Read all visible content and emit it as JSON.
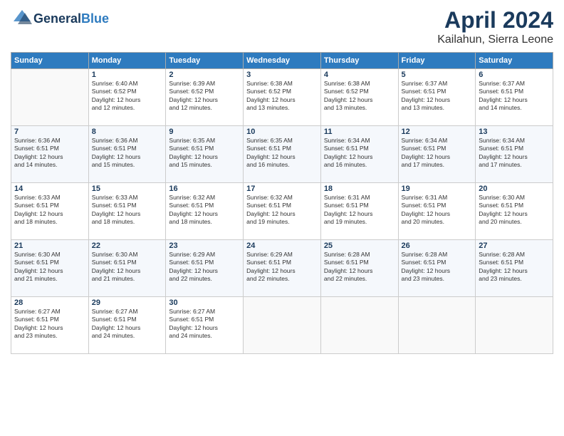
{
  "header": {
    "logo_general": "General",
    "logo_blue": "Blue",
    "month_title": "April 2024",
    "location": "Kailahun, Sierra Leone"
  },
  "days_of_week": [
    "Sunday",
    "Monday",
    "Tuesday",
    "Wednesday",
    "Thursday",
    "Friday",
    "Saturday"
  ],
  "weeks": [
    [
      {
        "day": "",
        "sunrise": "",
        "sunset": "",
        "daylight": ""
      },
      {
        "day": "1",
        "sunrise": "Sunrise: 6:40 AM",
        "sunset": "Sunset: 6:52 PM",
        "daylight": "Daylight: 12 hours and 12 minutes."
      },
      {
        "day": "2",
        "sunrise": "Sunrise: 6:39 AM",
        "sunset": "Sunset: 6:52 PM",
        "daylight": "Daylight: 12 hours and 12 minutes."
      },
      {
        "day": "3",
        "sunrise": "Sunrise: 6:38 AM",
        "sunset": "Sunset: 6:52 PM",
        "daylight": "Daylight: 12 hours and 13 minutes."
      },
      {
        "day": "4",
        "sunrise": "Sunrise: 6:38 AM",
        "sunset": "Sunset: 6:52 PM",
        "daylight": "Daylight: 12 hours and 13 minutes."
      },
      {
        "day": "5",
        "sunrise": "Sunrise: 6:37 AM",
        "sunset": "Sunset: 6:51 PM",
        "daylight": "Daylight: 12 hours and 13 minutes."
      },
      {
        "day": "6",
        "sunrise": "Sunrise: 6:37 AM",
        "sunset": "Sunset: 6:51 PM",
        "daylight": "Daylight: 12 hours and 14 minutes."
      }
    ],
    [
      {
        "day": "7",
        "sunrise": "Sunrise: 6:36 AM",
        "sunset": "Sunset: 6:51 PM",
        "daylight": "Daylight: 12 hours and 14 minutes."
      },
      {
        "day": "8",
        "sunrise": "Sunrise: 6:36 AM",
        "sunset": "Sunset: 6:51 PM",
        "daylight": "Daylight: 12 hours and 15 minutes."
      },
      {
        "day": "9",
        "sunrise": "Sunrise: 6:35 AM",
        "sunset": "Sunset: 6:51 PM",
        "daylight": "Daylight: 12 hours and 15 minutes."
      },
      {
        "day": "10",
        "sunrise": "Sunrise: 6:35 AM",
        "sunset": "Sunset: 6:51 PM",
        "daylight": "Daylight: 12 hours and 16 minutes."
      },
      {
        "day": "11",
        "sunrise": "Sunrise: 6:34 AM",
        "sunset": "Sunset: 6:51 PM",
        "daylight": "Daylight: 12 hours and 16 minutes."
      },
      {
        "day": "12",
        "sunrise": "Sunrise: 6:34 AM",
        "sunset": "Sunset: 6:51 PM",
        "daylight": "Daylight: 12 hours and 17 minutes."
      },
      {
        "day": "13",
        "sunrise": "Sunrise: 6:34 AM",
        "sunset": "Sunset: 6:51 PM",
        "daylight": "Daylight: 12 hours and 17 minutes."
      }
    ],
    [
      {
        "day": "14",
        "sunrise": "Sunrise: 6:33 AM",
        "sunset": "Sunset: 6:51 PM",
        "daylight": "Daylight: 12 hours and 18 minutes."
      },
      {
        "day": "15",
        "sunrise": "Sunrise: 6:33 AM",
        "sunset": "Sunset: 6:51 PM",
        "daylight": "Daylight: 12 hours and 18 minutes."
      },
      {
        "day": "16",
        "sunrise": "Sunrise: 6:32 AM",
        "sunset": "Sunset: 6:51 PM",
        "daylight": "Daylight: 12 hours and 18 minutes."
      },
      {
        "day": "17",
        "sunrise": "Sunrise: 6:32 AM",
        "sunset": "Sunset: 6:51 PM",
        "daylight": "Daylight: 12 hours and 19 minutes."
      },
      {
        "day": "18",
        "sunrise": "Sunrise: 6:31 AM",
        "sunset": "Sunset: 6:51 PM",
        "daylight": "Daylight: 12 hours and 19 minutes."
      },
      {
        "day": "19",
        "sunrise": "Sunrise: 6:31 AM",
        "sunset": "Sunset: 6:51 PM",
        "daylight": "Daylight: 12 hours and 20 minutes."
      },
      {
        "day": "20",
        "sunrise": "Sunrise: 6:30 AM",
        "sunset": "Sunset: 6:51 PM",
        "daylight": "Daylight: 12 hours and 20 minutes."
      }
    ],
    [
      {
        "day": "21",
        "sunrise": "Sunrise: 6:30 AM",
        "sunset": "Sunset: 6:51 PM",
        "daylight": "Daylight: 12 hours and 21 minutes."
      },
      {
        "day": "22",
        "sunrise": "Sunrise: 6:30 AM",
        "sunset": "Sunset: 6:51 PM",
        "daylight": "Daylight: 12 hours and 21 minutes."
      },
      {
        "day": "23",
        "sunrise": "Sunrise: 6:29 AM",
        "sunset": "Sunset: 6:51 PM",
        "daylight": "Daylight: 12 hours and 22 minutes."
      },
      {
        "day": "24",
        "sunrise": "Sunrise: 6:29 AM",
        "sunset": "Sunset: 6:51 PM",
        "daylight": "Daylight: 12 hours and 22 minutes."
      },
      {
        "day": "25",
        "sunrise": "Sunrise: 6:28 AM",
        "sunset": "Sunset: 6:51 PM",
        "daylight": "Daylight: 12 hours and 22 minutes."
      },
      {
        "day": "26",
        "sunrise": "Sunrise: 6:28 AM",
        "sunset": "Sunset: 6:51 PM",
        "daylight": "Daylight: 12 hours and 23 minutes."
      },
      {
        "day": "27",
        "sunrise": "Sunrise: 6:28 AM",
        "sunset": "Sunset: 6:51 PM",
        "daylight": "Daylight: 12 hours and 23 minutes."
      }
    ],
    [
      {
        "day": "28",
        "sunrise": "Sunrise: 6:27 AM",
        "sunset": "Sunset: 6:51 PM",
        "daylight": "Daylight: 12 hours and 23 minutes."
      },
      {
        "day": "29",
        "sunrise": "Sunrise: 6:27 AM",
        "sunset": "Sunset: 6:51 PM",
        "daylight": "Daylight: 12 hours and 24 minutes."
      },
      {
        "day": "30",
        "sunrise": "Sunrise: 6:27 AM",
        "sunset": "Sunset: 6:51 PM",
        "daylight": "Daylight: 12 hours and 24 minutes."
      },
      {
        "day": "",
        "sunrise": "",
        "sunset": "",
        "daylight": ""
      },
      {
        "day": "",
        "sunrise": "",
        "sunset": "",
        "daylight": ""
      },
      {
        "day": "",
        "sunrise": "",
        "sunset": "",
        "daylight": ""
      },
      {
        "day": "",
        "sunrise": "",
        "sunset": "",
        "daylight": ""
      }
    ]
  ]
}
